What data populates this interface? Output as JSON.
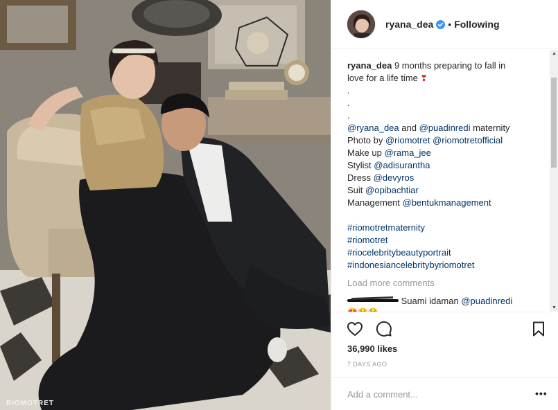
{
  "photo": {
    "watermark": "RIOMOTRET"
  },
  "header": {
    "username": "ryana_dea",
    "separator": "•",
    "follow_status": "Following"
  },
  "caption": {
    "username": "ryana_dea",
    "text_line1": "9 months preparing to fall in",
    "text_line2": "love for a life time",
    "heart": "❣",
    "dots": [
      ".",
      ".",
      "."
    ],
    "credit_maternity": {
      "mention1": "@ryana_dea",
      "and": " and ",
      "mention2": "@puadinredi",
      "suffix": " maternity"
    },
    "credit_photo": {
      "prefix": "Photo by ",
      "mention1": "@riomotret",
      "mention2": "@riomotretofficial"
    },
    "credit_makeup": {
      "prefix": "Make up ",
      "mention": "@rama_jee"
    },
    "credit_stylist": {
      "prefix": "Stylist ",
      "mention": "@adisurantha"
    },
    "credit_dress": {
      "prefix": "Dress ",
      "mention": "@devyros"
    },
    "credit_suit": {
      "prefix": "Suit ",
      "mention": "@opibachtiar"
    },
    "credit_management": {
      "prefix": "Management ",
      "mention": "@bentukmanagement"
    },
    "hashtags": [
      "#riomotretmaternity",
      "#riomotret",
      "#riocelebritybeautyportrait",
      "#indonesiancelebritybyriomotret"
    ]
  },
  "load_more": "Load more comments",
  "comment": {
    "text": "Suami idaman ",
    "mention": "@puadinredi",
    "emojis": "😍😢😢"
  },
  "likes": "36,990 likes",
  "timestamp": "7 DAYS AGO",
  "comment_input": {
    "placeholder": "Add a comment..."
  },
  "more_options": "•••",
  "colors": {
    "link": "#003569",
    "verified": "#3897f0",
    "muted": "#999999",
    "text": "#262626"
  },
  "icons": {
    "like": "heart-icon",
    "comment": "speech-bubble-icon",
    "save": "bookmark-icon",
    "verified": "verified-badge-icon"
  }
}
